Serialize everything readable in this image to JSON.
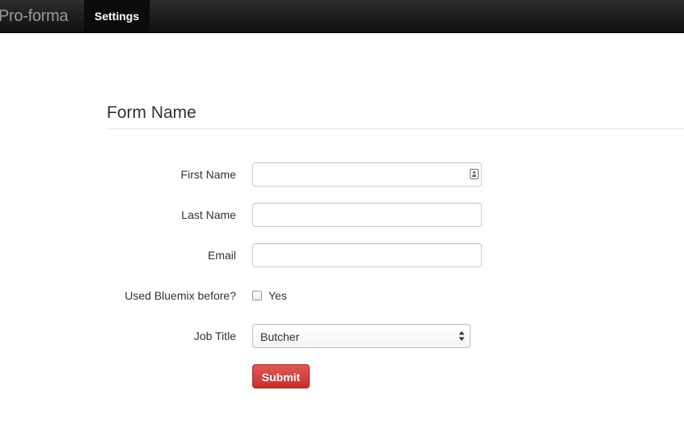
{
  "navbar": {
    "brand": "Pro-forma",
    "items": [
      {
        "label": "Settings",
        "active": true
      }
    ]
  },
  "form": {
    "legend": "Form Name",
    "fields": {
      "first_name": {
        "label": "First Name",
        "value": ""
      },
      "last_name": {
        "label": "Last Name",
        "value": ""
      },
      "email": {
        "label": "Email",
        "value": ""
      },
      "bluemix": {
        "label": "Used Bluemix before?",
        "option_label": "Yes",
        "checked": false
      },
      "job_title": {
        "label": "Job Title",
        "selected": "Butcher"
      }
    },
    "submit_label": "Submit"
  },
  "colors": {
    "navbar_bg": "#1b1b1b",
    "brand_text": "#9a9a9a",
    "submit_bg": "#d9534f"
  },
  "icons": {
    "contact_autofill": "contact-card-icon",
    "select_arrows": "up-down-arrows-icon"
  }
}
